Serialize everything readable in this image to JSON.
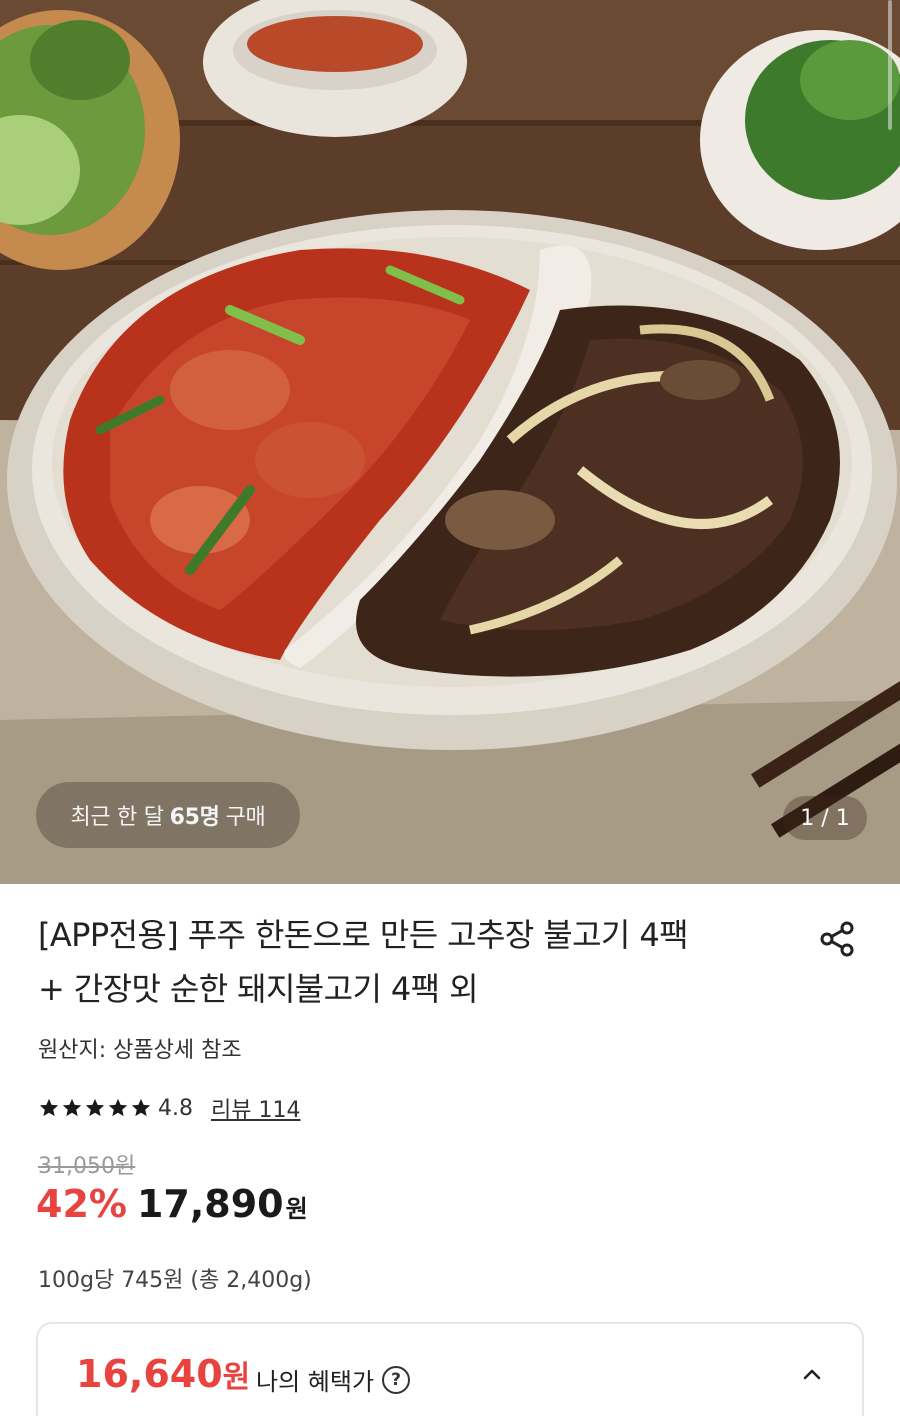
{
  "gallery": {
    "recent_prefix": "최근 한 달",
    "recent_count": "65명",
    "recent_suffix": "구매",
    "page_indicator": "1 / 1"
  },
  "product": {
    "title_line1": "[APP전용] 푸주 한돈으로 만든 고추장 불고기 4팩",
    "title_line2": "+ 간장맛 순한 돼지불고기 4팩 외",
    "origin": "원산지: 상품상세 참조",
    "rating": "4.8",
    "stars": 5,
    "review_link": "리뷰 114",
    "original_price": "31,050원",
    "discount_rate": "42%",
    "price": "17,890",
    "price_unit": "원",
    "unit_price": "100g당 745원 (총 2,400g)"
  },
  "benefit": {
    "price": "16,640",
    "price_unit": "원",
    "label": "나의 혜택가",
    "help_symbol": "?"
  },
  "colors": {
    "accent_red": "#e8433f",
    "text_dark": "#222222",
    "text_muted": "#9a9a9a",
    "border": "#e6e6e6"
  },
  "icons": {
    "share": "share-icon",
    "star": "star-icon",
    "help": "question-circle-icon",
    "expand": "chevron-up-icon"
  }
}
